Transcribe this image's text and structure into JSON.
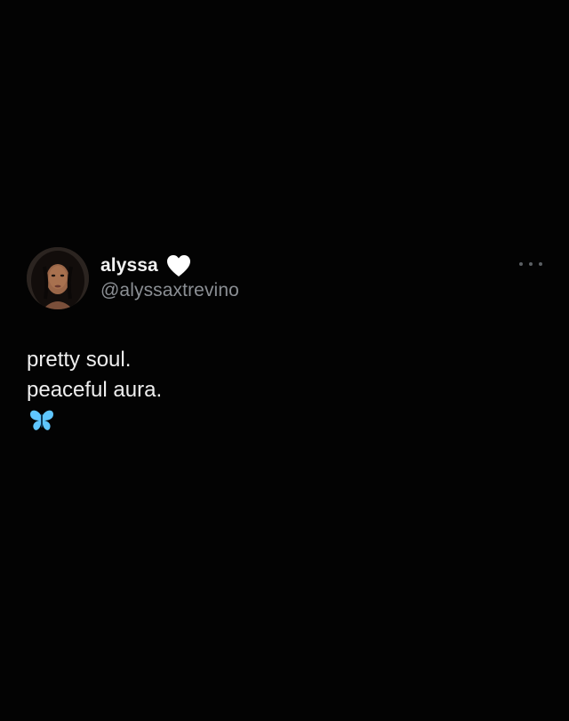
{
  "tweet": {
    "display_name": "alyssa",
    "name_emoji": "white-heart-icon",
    "handle": "@alyssaxtrevino",
    "more_icon": "more-options-icon",
    "lines": [
      "pretty soul.",
      "peaceful aura."
    ],
    "trailing_emoji": "blue-butterfly-icon"
  },
  "colors": {
    "background": "#030303",
    "text": "#eeeeee",
    "handle": "#8b8f94",
    "heart": "#ffffff",
    "butterfly": "#5fc6ff"
  }
}
